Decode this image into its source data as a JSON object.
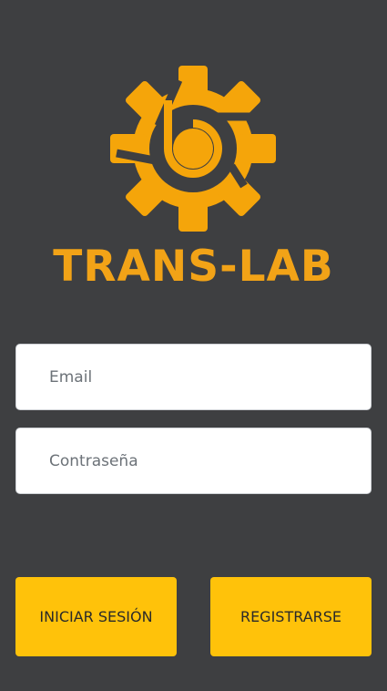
{
  "brand": {
    "name": "TRANS-LAB",
    "color": "#f2a317",
    "logo_icon": "gear-icon"
  },
  "form": {
    "email_placeholder": "Email",
    "password_placeholder": "Contraseña"
  },
  "actions": {
    "login_label": "INICIAR SESIÓN",
    "register_label": "REGISTRARSE",
    "button_color": "#ffc20a"
  },
  "theme": {
    "background": "#3e3f41"
  }
}
